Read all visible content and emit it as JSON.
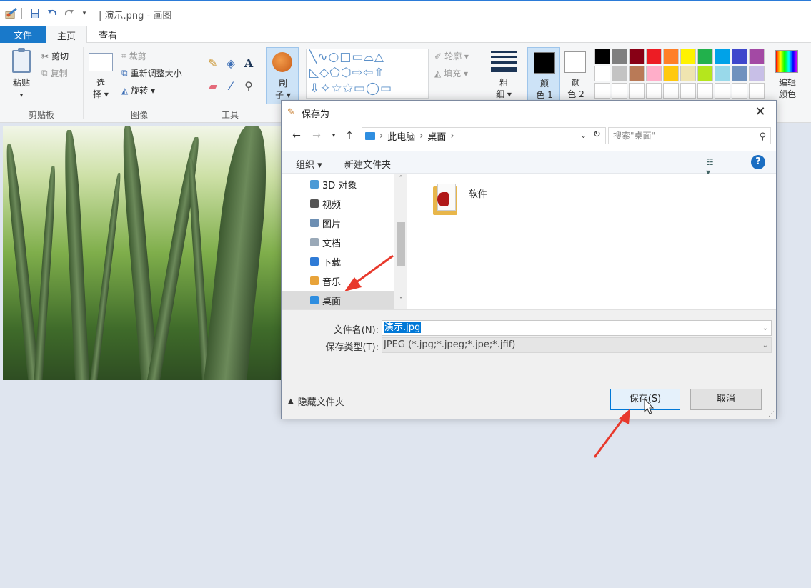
{
  "app": {
    "title": "| 演示.png - 画图",
    "quick_access": [
      "paint-app-icon",
      "save-icon",
      "undo-icon",
      "redo-icon",
      "customize-dropdown-icon"
    ]
  },
  "ribbon_tabs": {
    "file": "文件",
    "home": "主页",
    "view": "查看"
  },
  "ribbon": {
    "clipboard": {
      "label": "剪贴板",
      "paste": "粘贴",
      "cut": "剪切",
      "copy": "复制"
    },
    "image": {
      "label": "图像",
      "select_line1": "选",
      "select_line2": "择 ▾",
      "crop": "裁剪",
      "resize": "重新调整大小",
      "rotate": "旋转 ▾"
    },
    "tools": {
      "label": "工具"
    },
    "brushes": {
      "line1": "刷",
      "line2": "子 ▾"
    },
    "shapes": {
      "outline": "轮廓 ▾",
      "fill": "填充 ▾",
      "glyphs_row1": "╲∿○□▭⌓△",
      "glyphs_row2": "◺◇⬠⬡⇨⇦⇧",
      "glyphs_row3": "⇩✧☆✩▭◯▭"
    },
    "size": {
      "line1": "粗",
      "line2": "细 ▾"
    },
    "color1": {
      "line1": "颜",
      "line2": "色 1",
      "value": "#000000"
    },
    "color2": {
      "line1": "颜",
      "line2": "色 2",
      "value": "#ffffff"
    },
    "edit_colors": {
      "line1": "编辑",
      "line2": "颜色"
    },
    "palette_row1": [
      "#000000",
      "#7f7f7f",
      "#880015",
      "#ed1c24",
      "#ff7f27",
      "#fff200",
      "#22b14c",
      "#00a2e8",
      "#3f48cc",
      "#a349a4"
    ],
    "palette_row2": [
      "#ffffff",
      "#c3c3c3",
      "#b97a57",
      "#ffaec9",
      "#ffc90e",
      "#efe4b0",
      "#b5e61d",
      "#99d9ea",
      "#7092be",
      "#c8bfe7"
    ]
  },
  "dialog": {
    "title": "保存为",
    "close": "✕",
    "breadcrumb": [
      "此电脑",
      "桌面"
    ],
    "search_placeholder": "搜索\"桌面\"",
    "organize": "组织 ▾",
    "new_folder": "新建文件夹",
    "nav_items": [
      {
        "label": "3D 对象",
        "color": "#4b9ad6"
      },
      {
        "label": "视频",
        "color": "#555555"
      },
      {
        "label": "图片",
        "color": "#6d8fb3"
      },
      {
        "label": "文档",
        "color": "#9aa9b8"
      },
      {
        "label": "下载",
        "color": "#2f7bd6"
      },
      {
        "label": "音乐",
        "color": "#e8a33a"
      },
      {
        "label": "桌面",
        "color": "#2f8ee0"
      }
    ],
    "selected_nav": "桌面",
    "files": [
      {
        "name": "软件"
      }
    ],
    "filename_label": "文件名(N):",
    "filename_value": "演示.jpg",
    "filetype_label": "保存类型(T):",
    "filetype_value": "JPEG (*.jpg;*.jpeg;*.jpe;*.jfif)",
    "hide_folders": "隐藏文件夹",
    "save_button": "保存(S)",
    "cancel_button": "取消"
  },
  "annotations": {
    "arrow_color": "#e8392c"
  }
}
